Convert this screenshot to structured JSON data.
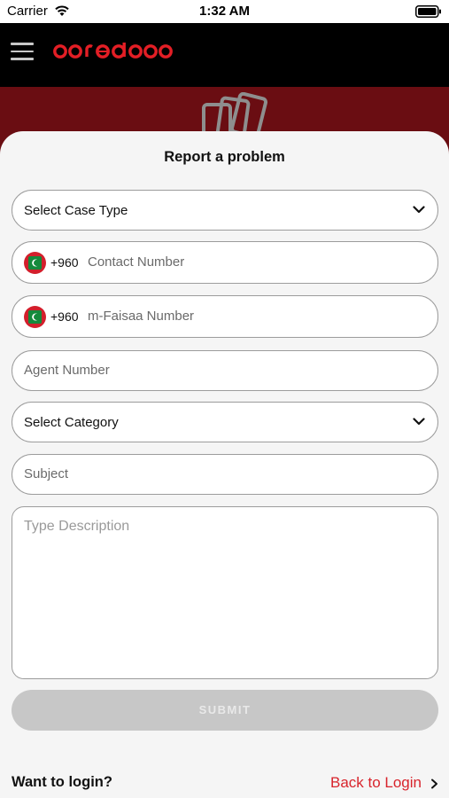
{
  "status_bar": {
    "carrier": "Carrier",
    "time": "1:32 AM"
  },
  "header": {
    "brand": "ooredoo",
    "menu_icon": "hamburger-menu-icon"
  },
  "banner": {
    "icon": "cards-icon",
    "color": "#6a0d12"
  },
  "form": {
    "title": "Report a problem",
    "case_type_placeholder": "Select Case Type",
    "contact": {
      "dial_code": "+960",
      "placeholder": "Contact Number"
    },
    "mfaisaa": {
      "dial_code": "+960",
      "placeholder": "m-Faisaa Number"
    },
    "agent_placeholder": "Agent Number",
    "category_placeholder": "Select Category",
    "subject_placeholder": "Subject",
    "description_placeholder": "Type Description",
    "submit_label": "SUBMIT"
  },
  "footer": {
    "question": "Want to login?",
    "link_label": "Back to Login"
  },
  "colors": {
    "accent": "#d8242c",
    "header_bg": "#000000",
    "submit_disabled": "#c7c7c7"
  }
}
